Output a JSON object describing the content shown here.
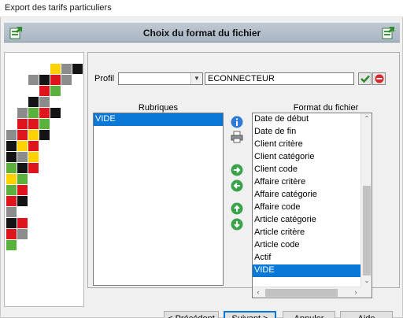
{
  "window": {
    "title": "Export des tarifs particuliers"
  },
  "header": {
    "title": "Choix du format du fichier"
  },
  "profile": {
    "label": "Profil",
    "combo_value": "",
    "text_value": "ECONNECTEUR",
    "validate_icon": "check-icon",
    "cancel_icon": "no-entry-icon"
  },
  "rubriques": {
    "header": "Rubriques",
    "items": [
      {
        "label": "VIDE",
        "selected": true
      }
    ]
  },
  "format": {
    "header": "Format du fichier",
    "items": [
      {
        "label": "Date de début",
        "selected": false
      },
      {
        "label": "Date de fin",
        "selected": false
      },
      {
        "label": "Client critère",
        "selected": false
      },
      {
        "label": "Client catégorie",
        "selected": false
      },
      {
        "label": "Client code",
        "selected": false
      },
      {
        "label": "Affaire critère",
        "selected": false
      },
      {
        "label": "Affaire catégorie",
        "selected": false
      },
      {
        "label": "Affaire code",
        "selected": false
      },
      {
        "label": "Article catégorie",
        "selected": false
      },
      {
        "label": "Article critère",
        "selected": false
      },
      {
        "label": "Article code",
        "selected": false
      },
      {
        "label": "Actif",
        "selected": false
      },
      {
        "label": "VIDE",
        "selected": true
      }
    ]
  },
  "middle_buttons": [
    "info-icon",
    "print-icon",
    "arrow-right-icon",
    "arrow-left-icon",
    "arrow-up-icon",
    "arrow-down-icon"
  ],
  "footer": {
    "prev": "< Précédent",
    "next": "Suivant >",
    "cancel": "Annuler",
    "help": "Aide"
  },
  "colors": {
    "banner": "#b4c0cc",
    "selection": "#0a78d7",
    "mosaic_red": "#e0141c",
    "mosaic_yellow": "#ffd200",
    "mosaic_green": "#5ab23c",
    "mosaic_grey": "#8c8c8c",
    "mosaic_black": "#141414"
  }
}
